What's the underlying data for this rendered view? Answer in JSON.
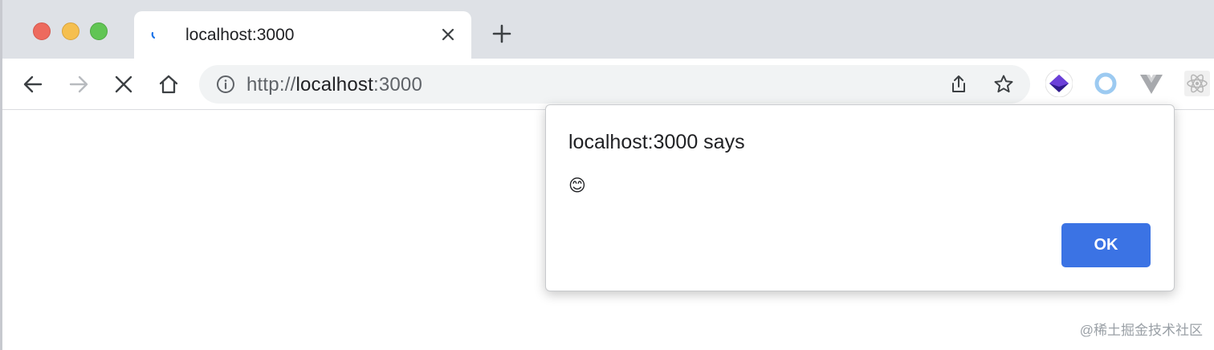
{
  "tab": {
    "title": "localhost:3000",
    "icons": [
      "loading-spinner",
      "close-x"
    ]
  },
  "toolbar": {
    "url": {
      "scheme": "http://",
      "host": "localhost",
      "port": ":3000"
    },
    "icons": [
      "back-arrow",
      "forward-arrow",
      "stop-x",
      "home",
      "info",
      "share",
      "star"
    ]
  },
  "extensions": [
    "purple-layers",
    "blue-ring",
    "vue-v",
    "react-gear"
  ],
  "dialog": {
    "title": "localhost:3000 says",
    "message": "😊",
    "ok_label": "OK"
  },
  "watermark": "@稀土掘金技术社区",
  "colors": {
    "tabstrip": "#dee1e6",
    "ok_button": "#3b73e4",
    "omnibox": "#f1f3f4"
  }
}
